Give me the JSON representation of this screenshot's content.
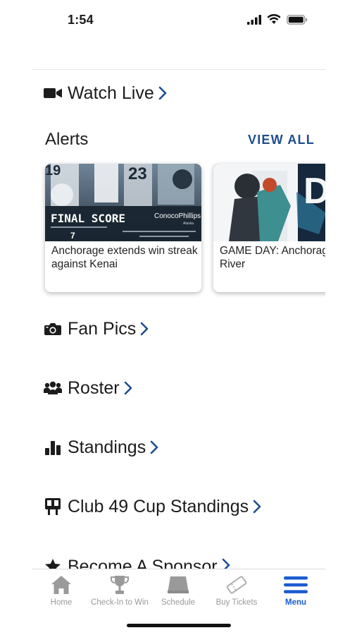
{
  "status": {
    "time": "1:54"
  },
  "watch_live": {
    "label": "Watch Live",
    "icon": "video-camera-icon"
  },
  "alerts": {
    "title": "Alerts",
    "view_all": "VIEW ALL",
    "cards": [
      {
        "headline": "Anchorage extends win streak against Kenai",
        "image_text": {
          "jerseys": [
            "19",
            "23"
          ],
          "title": "FINAL SCORE",
          "sponsor": "ConocoPhillips",
          "sponsor_sub": "Alaska",
          "score": "7"
        }
      },
      {
        "headline": "GAME DAY: Anchorage vs Kenai River",
        "image_text": {
          "big_letters": "DA"
        }
      }
    ]
  },
  "menu": [
    {
      "label": "Fan Pics",
      "icon": "camera-icon"
    },
    {
      "label": "Roster",
      "icon": "people-icon"
    },
    {
      "label": "Standings",
      "icon": "bar-chart-icon"
    },
    {
      "label": "Club 49 Cup Standings",
      "icon": "scoreboard-icon"
    },
    {
      "label": "Become A Sponsor",
      "icon": "star-icon"
    }
  ],
  "tabs": [
    {
      "label": "Home",
      "icon": "home-icon",
      "active": false
    },
    {
      "label": "Check-In to Win",
      "icon": "trophy-icon",
      "active": false
    },
    {
      "label": "Schedule",
      "icon": "rink-icon",
      "active": false
    },
    {
      "label": "Buy Tickets",
      "icon": "ticket-icon",
      "active": false
    },
    {
      "label": "Menu",
      "icon": "hamburger-icon",
      "active": true
    }
  ],
  "colors": {
    "accent": "#1e4e8f",
    "tab_active": "#1a5bd0",
    "tab_inactive": "#9a9a9a",
    "text": "#1c1c1c"
  }
}
